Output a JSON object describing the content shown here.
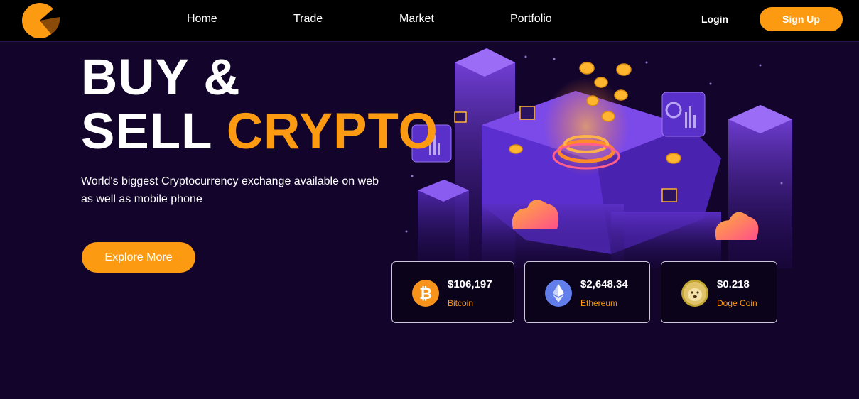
{
  "nav": {
    "links": [
      "Home",
      "Trade",
      "Market",
      "Portfolio"
    ],
    "login": "Login",
    "signup": "Sign Up"
  },
  "hero": {
    "title_line1": "BUY &",
    "title_line2_a": "SELL ",
    "title_line2_b": "CRYPTO",
    "subtitle": "World's biggest Cryptocurrency exchange available on web as well as mobile phone",
    "cta": "Explore More"
  },
  "coins": [
    {
      "price": "$106,197",
      "name": "Bitcoin",
      "icon": "bitcoin-icon",
      "color": "#f7931a"
    },
    {
      "price": "$2,648.34",
      "name": "Ethereum",
      "icon": "ethereum-icon",
      "color": "#627eea"
    },
    {
      "price": "$0.218",
      "name": "Doge Coin",
      "icon": "dogecoin-icon",
      "color": "#c2a633"
    }
  ],
  "colors": {
    "accent": "#fc9a12",
    "background": "#13042c",
    "navbar": "#000000"
  }
}
